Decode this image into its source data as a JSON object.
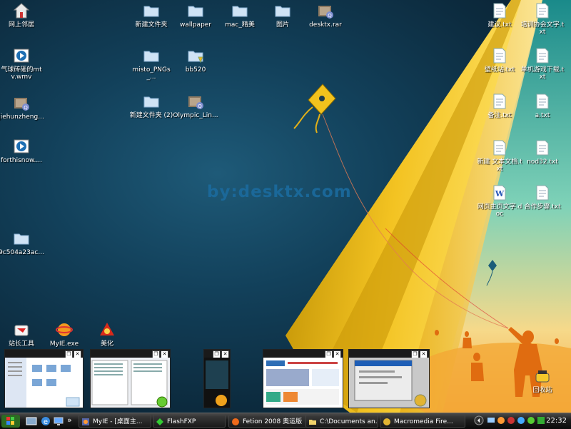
{
  "desktop": {
    "watermark": "by:desktx.com",
    "left_icons": [
      {
        "label": "网上邻居",
        "icon": "network-icon"
      },
      {
        "label": "气球砖砸的mtv.wmv",
        "icon": "media-file-icon"
      },
      {
        "label": "jiehunzheng...",
        "icon": "archive-icon"
      },
      {
        "label": "forthisnow....",
        "icon": "media-file-icon"
      },
      {
        "label": "9c504a23ac...",
        "icon": "folder-icon"
      }
    ],
    "mid_icons": [
      {
        "label": "新建文件夹",
        "icon": "folder-icon"
      },
      {
        "label": "wallpaper",
        "icon": "folder-icon"
      },
      {
        "label": "mac_精美",
        "icon": "folder-icon"
      },
      {
        "label": "图片",
        "icon": "folder-icon"
      },
      {
        "label": "desktx.rar",
        "icon": "archive-icon"
      },
      {
        "label": "misto_PNGs_...",
        "icon": "folder-icon"
      },
      {
        "label": "bb520",
        "icon": "shared-folder-icon"
      },
      {
        "label": "新建文件夹 (2)",
        "icon": "folder-icon"
      },
      {
        "label": "Olympic_Lin...",
        "icon": "archive-icon"
      }
    ],
    "right_icons": [
      {
        "label": "建议.txt",
        "icon": "text-file-icon"
      },
      {
        "label": "培训协会文字.txt",
        "icon": "text-file-icon"
      },
      {
        "label": "壁纸站.txt",
        "icon": "text-file-icon"
      },
      {
        "label": "单机游戏下载.txt",
        "icon": "text-file-icon"
      },
      {
        "label": "备注.txt",
        "icon": "text-file-icon"
      },
      {
        "label": "a.txt",
        "icon": "text-file-icon"
      },
      {
        "label": "新建 文本文档.txt",
        "icon": "text-file-icon"
      },
      {
        "label": "nod32.txt",
        "icon": "text-file-icon"
      },
      {
        "label": "网页主页文字.doc",
        "icon": "word-doc-icon"
      },
      {
        "label": "合作步骤.txt",
        "icon": "text-file-icon"
      }
    ],
    "bottom_icons": [
      {
        "label": "站长工具",
        "icon": "toolbox-icon"
      },
      {
        "label": "MyIE.exe",
        "icon": "browser-icon"
      },
      {
        "label": "美化",
        "icon": "beautify-icon"
      }
    ],
    "recycle_bin": {
      "label": "回收站",
      "icon": "recycle-bin-icon"
    }
  },
  "thumbnails": [
    {
      "name": "explorer-window",
      "kind": "explorer"
    },
    {
      "name": "flashfxp-window",
      "kind": "filelist"
    },
    {
      "name": "fetion-window",
      "kind": "chat"
    },
    {
      "name": "browser-window",
      "kind": "web"
    },
    {
      "name": "fireworks-window",
      "kind": "dialog"
    }
  ],
  "taskbar": {
    "quicklaunch_more": "»",
    "buttons": [
      {
        "label": "MyIE - [桌面主...",
        "icon": "browser-icon"
      },
      {
        "label": "FlashFXP",
        "icon": "flashfxp-icon"
      },
      {
        "label": "Fetion 2008 奥运版",
        "icon": "fetion-icon"
      },
      {
        "label": "C:\\Documents an...",
        "icon": "folder-icon"
      },
      {
        "label": "Macromedia Fire...",
        "icon": "fireworks-icon"
      }
    ],
    "clock": "22:32"
  }
}
